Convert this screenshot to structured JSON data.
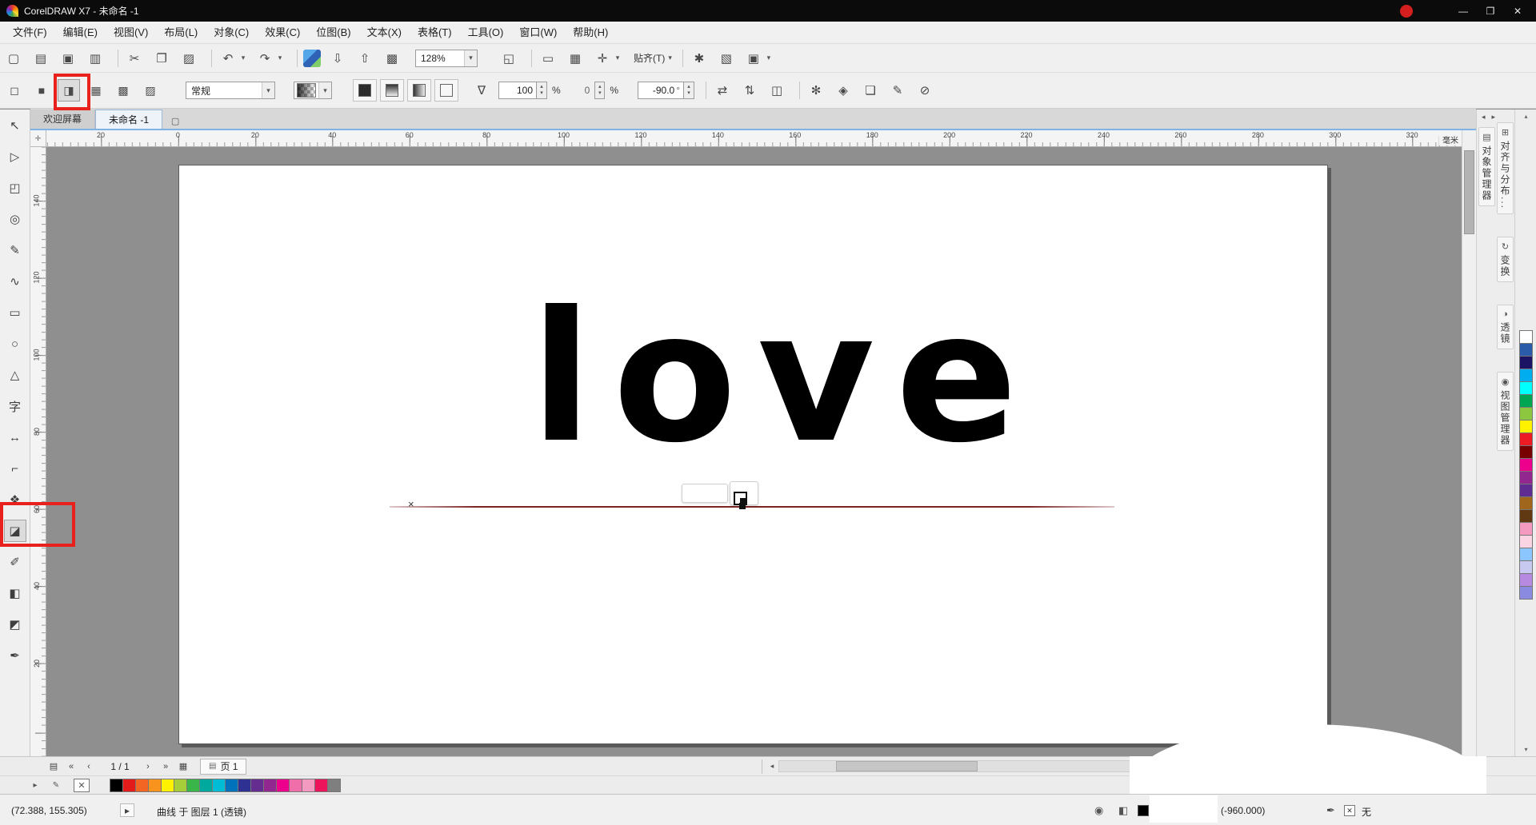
{
  "window": {
    "title": "CorelDRAW X7 - 未命名 -1",
    "minimize": "—",
    "maximize": "❐",
    "close": "✕"
  },
  "menu": {
    "items": [
      "文件(F)",
      "编辑(E)",
      "视图(V)",
      "布局(L)",
      "对象(C)",
      "效果(C)",
      "位图(B)",
      "文本(X)",
      "表格(T)",
      "工具(O)",
      "窗口(W)",
      "帮助(H)"
    ]
  },
  "toolbar": {
    "new": "▢",
    "open": "▤",
    "save": "▣",
    "print": "▥",
    "cut": "✂",
    "copy": "❐",
    "paste": "▨",
    "undo": "↶",
    "redo": "↷",
    "dropdown": "▾",
    "import": "⇩",
    "export": "⇧",
    "launcher": "▩",
    "zoom_value": "128%",
    "fullscreen": "◱",
    "show_rulers": "▭",
    "show_grid": "▦",
    "snap_icon": "✛",
    "snap_label": "贴齐(T)",
    "options1": "✱",
    "options2": "▧",
    "options3": "▣"
  },
  "property_bar": {
    "type_buttons": [
      {
        "name": "no-transparency-button",
        "glyph": "◻",
        "pressed": false
      },
      {
        "name": "uniform-transparency-button",
        "glyph": "■",
        "pressed": false
      },
      {
        "name": "fountain-transparency-button",
        "glyph": "◨",
        "pressed": true
      },
      {
        "name": "pattern-transparency-button",
        "glyph": "▦",
        "pressed": false
      },
      {
        "name": "texture-transparency-button",
        "glyph": "▩",
        "pressed": false
      },
      {
        "name": "bitmap-transparency-button",
        "glyph": "▨",
        "pressed": false
      }
    ],
    "merge_mode": "常规",
    "picker": "∇",
    "opacity_value": "100",
    "percent": "%",
    "midpoint_value": "0",
    "percent2": "%",
    "angle_value": "-90.0",
    "degree": "°",
    "up": "▴",
    "down": "▾",
    "mirror1": "⇄",
    "mirror2": "⇅",
    "mirror3": "◫",
    "freeze": "✻",
    "diamond": "◈",
    "copy_btn": "❏",
    "edit_btn": "✎",
    "none_btn": "⊘"
  },
  "tabs": [
    {
      "name": "tab-welcome-screen",
      "label": "欢迎屏幕",
      "active": false
    },
    {
      "name": "tab-untitled-1",
      "label": "未命名 -1",
      "active": true
    }
  ],
  "new_tab_glyph": "▢",
  "h_ruler": {
    "labels": [
      "20",
      "0",
      "20",
      "40",
      "60",
      "80",
      "100",
      "120",
      "140",
      "160",
      "180",
      "200",
      "220",
      "240",
      "260",
      "280",
      "300",
      "320"
    ],
    "unit": "毫米"
  },
  "v_ruler": {
    "labels": [
      "140",
      "120",
      "100",
      "80",
      "60",
      "40",
      "20"
    ]
  },
  "toolbox": {
    "tools": [
      {
        "name": "pick-tool",
        "glyph": "↖",
        "active": false
      },
      {
        "name": "shape-tool",
        "glyph": "▷",
        "active": false
      },
      {
        "name": "crop-tool",
        "glyph": "◰",
        "active": false
      },
      {
        "name": "zoom-tool",
        "glyph": "◎",
        "active": false
      },
      {
        "name": "freehand-tool",
        "glyph": "✎",
        "active": false
      },
      {
        "name": "artistic-media-tool",
        "glyph": "∿",
        "active": false
      },
      {
        "name": "rectangle-tool",
        "glyph": "▭",
        "active": false
      },
      {
        "name": "ellipse-tool",
        "glyph": "○",
        "active": false
      },
      {
        "name": "polygon-tool",
        "glyph": "△",
        "active": false
      },
      {
        "name": "text-tool",
        "glyph": "字",
        "active": false
      },
      {
        "name": "dimension-tool",
        "glyph": "↔",
        "active": false
      },
      {
        "name": "connector-tool",
        "glyph": "⌐",
        "active": false
      },
      {
        "name": "blend-tool",
        "glyph": "❖",
        "active": false
      },
      {
        "name": "transparency-tool",
        "glyph": "◪",
        "active": true
      },
      {
        "name": "eyedropper-tool",
        "glyph": "✐",
        "active": false
      },
      {
        "name": "interactive-fill-tool",
        "glyph": "◧",
        "active": false
      },
      {
        "name": "smart-fill-tool",
        "glyph": "◩",
        "active": false
      },
      {
        "name": "outline-pen-tool",
        "glyph": "✒",
        "active": false
      }
    ]
  },
  "canvas": {
    "word": "love",
    "node_mark": "×"
  },
  "dockers": {
    "arrow_left": "◂",
    "arrow_right": "▸",
    "left_tabs": [
      {
        "name": "docker-tab-object-manager",
        "icon": "▤",
        "label": "对象管理器"
      }
    ],
    "right_tabs": [
      {
        "name": "docker-tab-align-distribute",
        "icon": "⊞",
        "label": "对齐与分布..."
      },
      {
        "name": "docker-tab-transform",
        "icon": "↻",
        "label": "变换"
      },
      {
        "name": "docker-tab-lens",
        "icon": "◑",
        "label": "透镜"
      },
      {
        "name": "docker-tab-view-manager",
        "icon": "◉",
        "label": "视图管理器"
      }
    ]
  },
  "palette_right": {
    "up": "▴",
    "down": "▾",
    "colors": [
      "#ffffff",
      "#2a5caa",
      "#1b1464",
      "#00aeef",
      "#00ffff",
      "#00a651",
      "#8dc63f",
      "#fff200",
      "#ed1c24",
      "#790000",
      "#ec008c",
      "#92278f",
      "#5f2c91",
      "#a0661c",
      "#603913",
      "#f49ac1",
      "#fbd4e4",
      "#8cc6ff",
      "#c7c9f0",
      "#b58ae0",
      "#8a8ae0"
    ]
  },
  "palette_bottom": {
    "flyout": "▸",
    "tool_icon": "✎",
    "no_color": "✕",
    "more": "»",
    "colors": [
      "#000000",
      "#e31b1b",
      "#f26522",
      "#f8941d",
      "#fff200",
      "#a6ce39",
      "#39b54a",
      "#00a99d",
      "#00bcd4",
      "#0072bc",
      "#2e3192",
      "#662d91",
      "#92278f",
      "#ec008c",
      "#f06eaa",
      "#f49ac1",
      "#ed145b",
      "#7f7f7f"
    ]
  },
  "page_nav": {
    "page_icon": "▤",
    "first": "«",
    "prev": "‹",
    "label": "1 / 1",
    "next": "›",
    "last": "»",
    "add": "▦",
    "page_tab": "页 1",
    "scroll_left": "◂",
    "scroll_right": "▸"
  },
  "status_bar": {
    "coords": "(72.388, 155.305)",
    "doc_icon": "▸",
    "object_info": "曲线 于 图层 1 (透镜)",
    "eye_icon": "◉",
    "fill_icon": "◧",
    "fill_value": "(-960.000)",
    "outline_icon": "✒",
    "outline_none": "✕",
    "outline_value": "无"
  },
  "colors": {
    "annotation": "#e8211c",
    "canvas_bg": "#8f8f8f",
    "accent_blue": "#7fb2e5",
    "gradient_line": "#7a2424",
    "title_bar": "#0b0b0b"
  }
}
